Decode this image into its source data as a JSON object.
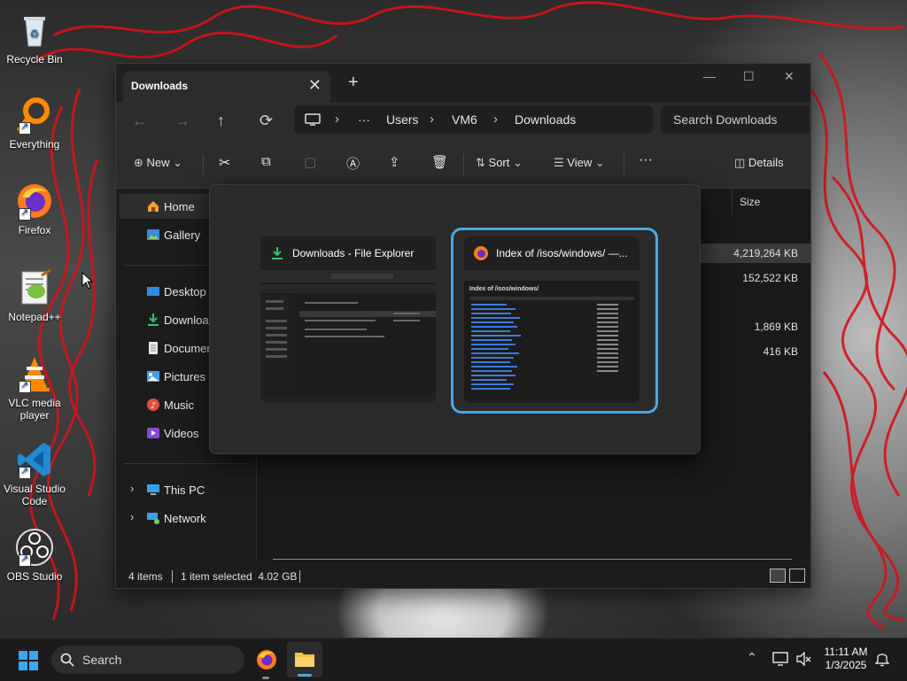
{
  "desktop": {
    "icons": [
      {
        "label": "Recycle Bin",
        "icon": "recycle-bin-icon"
      },
      {
        "label": "Everything",
        "icon": "everything-search-icon"
      },
      {
        "label": "Firefox",
        "icon": "firefox-icon"
      },
      {
        "label": "Notepad++",
        "icon": "notepad-plus-plus-icon"
      },
      {
        "label": "VLC media player",
        "icon": "vlc-icon"
      },
      {
        "label": "Visual Studio Code",
        "icon": "vscode-icon"
      },
      {
        "label": "OBS Studio",
        "icon": "obs-icon"
      }
    ]
  },
  "window": {
    "tab_title": "Downloads",
    "tab_close": "✕",
    "new_tab": "+",
    "controls": {
      "minimize": "—",
      "maximize": "☐",
      "close": "✕"
    },
    "nav": {
      "back": "←",
      "forward": "→",
      "up": "↑",
      "refresh": "⟳"
    },
    "address": {
      "more": "···",
      "segments": [
        "Users",
        "VM6",
        "Downloads"
      ],
      "sep": "›"
    },
    "search_placeholder": "Search Downloads",
    "commands": {
      "new": "New",
      "sort": "Sort",
      "view": "View",
      "more": "···",
      "details": "Details"
    },
    "sidebar": {
      "home": "Home",
      "gallery": "Gallery",
      "desktop": "Desktop",
      "downloads": "Downloads",
      "documents": "Documents",
      "pictures": "Pictures",
      "music": "Music",
      "videos": "Videos",
      "this_pc": "This PC",
      "network": "Network"
    },
    "content": {
      "size_header": "Size",
      "sizes": [
        "4,219,264 KB",
        "152,522 KB",
        "1,869 KB",
        "416 KB"
      ]
    },
    "status": {
      "items": "4 items",
      "selected": "1 item selected  4.02 GB"
    }
  },
  "switcher": {
    "thumbs": [
      {
        "title": "Downloads - File Explorer",
        "icon": "download-arrow-icon"
      },
      {
        "title": "Index of /isos/windows/ —...",
        "icon": "firefox-icon",
        "page_heading": "Index of /isos/windows/"
      }
    ]
  },
  "taskbar": {
    "search": "Search",
    "time": "11:11 AM",
    "date": "1/3/2025"
  },
  "colors": {
    "accent": "#4aa6e8",
    "window_bg": "#1c1c1c",
    "scribble": "#d2141c"
  }
}
